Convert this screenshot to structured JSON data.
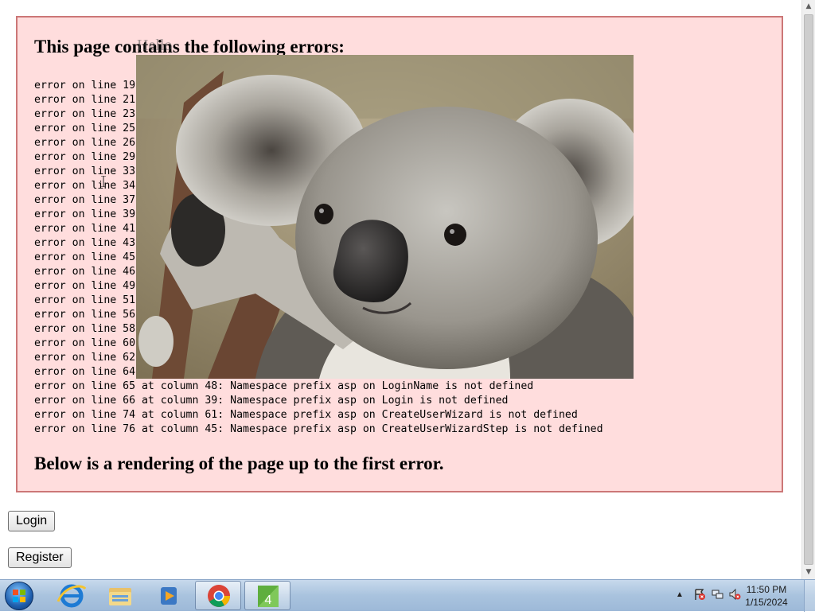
{
  "window_title_ghost": "Hello",
  "error_box": {
    "heading": "This page contains the following errors:",
    "errors": [
      "error on line 19",
      "error on line 21",
      "error on line 23",
      "error on line 25",
      "error on line 26",
      "error on line 29",
      "error on line 33",
      "error on line 34",
      "error on line 37",
      "error on line 39",
      "error on line 41",
      "error on line 43",
      "error on line 45",
      "error on line 46",
      "error on line 49",
      "error on line 51",
      "error on line 56",
      "error on line 58",
      "error on line 60",
      "error on line 62",
      "error on line 64",
      "error on line 65 at column 48: Namespace prefix asp on LoginName is not defined",
      "error on line 66 at column 39: Namespace prefix asp on Login is not defined",
      "error on line 74 at column 61: Namespace prefix asp on CreateUserWizard is not defined",
      "error on line 76 at column 45: Namespace prefix asp on CreateUserWizardStep is not defined"
    ],
    "footer": "Below is a rendering of the page up to the first error."
  },
  "image": {
    "subject": "koala"
  },
  "buttons": {
    "login": "Login",
    "register": "Register"
  },
  "taskbar": {
    "items": [
      "start-button",
      "internet-explorer-icon",
      "windows-explorer-icon",
      "media-player-icon",
      "chrome-icon",
      "app-icon"
    ],
    "active": [
      "chrome-icon",
      "app-icon"
    ],
    "clock_time": "11:50 PM",
    "clock_date": "1/15/2024"
  },
  "colors": {
    "error_bg": "#ffdddd",
    "error_border": "#cc7777",
    "taskbar": "#a9c3de"
  }
}
